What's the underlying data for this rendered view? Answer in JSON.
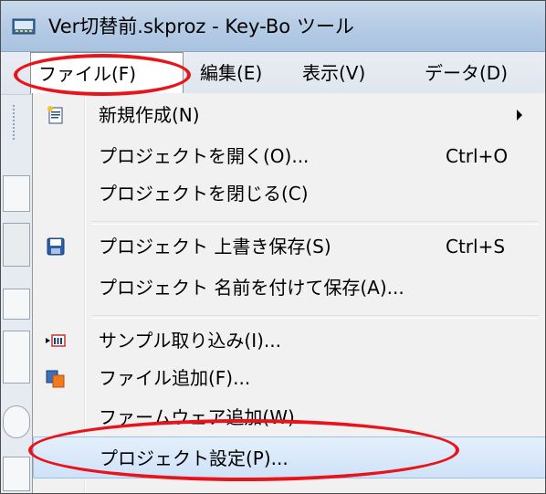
{
  "window": {
    "title": "Ver切替前.skproz - Key-Bo ツール"
  },
  "menubar": {
    "items": [
      {
        "label": "ファイル(F)"
      },
      {
        "label": "編集(E)"
      },
      {
        "label": "表示(V)"
      },
      {
        "label": "データ(D)"
      }
    ]
  },
  "file_menu": {
    "items": [
      {
        "label": "新規作成(N)",
        "shortcut": "",
        "icon": "new-document-icon",
        "submenu": true
      },
      {
        "label": "プロジェクトを開く(O)...",
        "shortcut": "Ctrl+O",
        "icon": "",
        "submenu": false
      },
      {
        "label": "プロジェクトを閉じる(C)",
        "shortcut": "",
        "icon": "",
        "submenu": false
      },
      {
        "label": "プロジェクト 上書き保存(S)",
        "shortcut": "Ctrl+S",
        "icon": "save-icon",
        "submenu": false
      },
      {
        "label": "プロジェクト 名前を付けて保存(A)...",
        "shortcut": "",
        "icon": "",
        "submenu": false
      },
      {
        "label": "サンプル取り込み(I)...",
        "shortcut": "",
        "icon": "import-sample-icon",
        "submenu": false
      },
      {
        "label": "ファイル追加(F)...",
        "shortcut": "",
        "icon": "add-file-icon",
        "submenu": false
      },
      {
        "label": "ファームウェア追加(W)...",
        "shortcut": "",
        "icon": "",
        "submenu": false
      },
      {
        "label": "プロジェクト設定(P)...",
        "shortcut": "",
        "icon": "",
        "submenu": false,
        "highlighted": true
      }
    ]
  },
  "colors": {
    "annotation": "#e8141b",
    "highlight": "#cfe2f8",
    "titlebar": "#b7cde6"
  }
}
